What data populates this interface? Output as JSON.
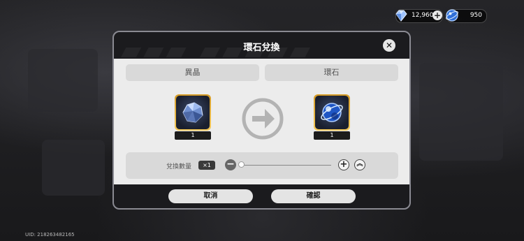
{
  "currency": {
    "crystal_value": "12,960",
    "stone_value": "950"
  },
  "dialog": {
    "title": "環石兌換",
    "tab_left": "異晶",
    "tab_right": "環石",
    "item_left_count": "1",
    "item_right_count": "1",
    "quantity_label": "兌換數量",
    "quantity_badge": "×1",
    "cancel_label": "取消",
    "confirm_label": "確認"
  },
  "footer": {
    "uid": "UID: 218263482165"
  },
  "icons": [
    "crystal-gem-icon",
    "stone-orb-icon",
    "plus-icon",
    "close-icon",
    "arrow-right-icon",
    "minus-icon",
    "double-chevron-up-icon"
  ],
  "colors": {
    "frame_gold": "#f4c95a",
    "panel": "#ececec",
    "dialog_bg": "#1b1b1e"
  }
}
